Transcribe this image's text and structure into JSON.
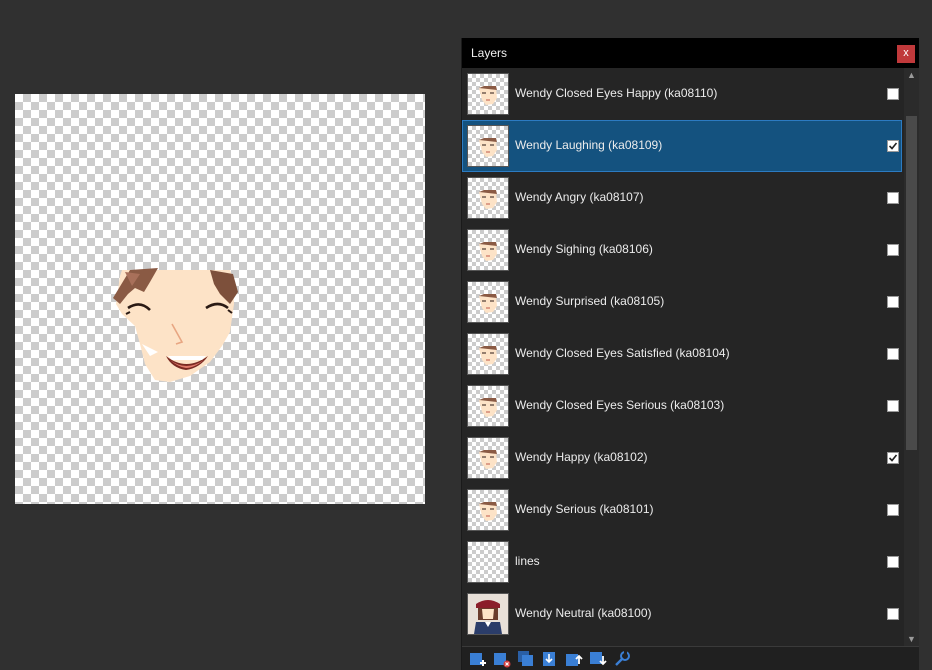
{
  "panel": {
    "title": "Layers",
    "close_label": "x"
  },
  "layers": [
    {
      "name": "Wendy Closed Eyes Happy (ka08110)",
      "visible": false,
      "selected": false,
      "thumb": "face-icon"
    },
    {
      "name": "Wendy Laughing (ka08109)",
      "visible": true,
      "selected": true,
      "thumb": "face-icon"
    },
    {
      "name": "Wendy Angry (ka08107)",
      "visible": false,
      "selected": false,
      "thumb": "face-icon"
    },
    {
      "name": "Wendy Sighing (ka08106)",
      "visible": false,
      "selected": false,
      "thumb": "face-icon"
    },
    {
      "name": "Wendy Surprised (ka08105)",
      "visible": false,
      "selected": false,
      "thumb": "face-icon"
    },
    {
      "name": "Wendy Closed Eyes Satisfied (ka08104)",
      "visible": false,
      "selected": false,
      "thumb": "face-icon"
    },
    {
      "name": "Wendy Closed Eyes Serious (ka08103)",
      "visible": false,
      "selected": false,
      "thumb": "face-icon"
    },
    {
      "name": "Wendy Happy (ka08102)",
      "visible": true,
      "selected": false,
      "thumb": "face-icon"
    },
    {
      "name": "Wendy Serious (ka08101)",
      "visible": false,
      "selected": false,
      "thumb": "face-icon"
    },
    {
      "name": "lines",
      "visible": false,
      "selected": false,
      "thumb": "empty"
    },
    {
      "name": "Wendy Neutral (ka08100)",
      "visible": false,
      "selected": false,
      "thumb": "character-icon"
    }
  ],
  "toolbar": [
    {
      "name": "add-layer-icon"
    },
    {
      "name": "delete-layer-icon"
    },
    {
      "name": "duplicate-layer-icon"
    },
    {
      "name": "merge-layer-down-icon"
    },
    {
      "name": "move-layer-up-icon"
    },
    {
      "name": "move-layer-down-icon"
    },
    {
      "name": "layer-properties-icon"
    }
  ],
  "colors": {
    "background": "#303030",
    "panel": "#252525",
    "selection": "#14527f",
    "close_button": "#c0393b",
    "accent_icon": "#3a7fd5"
  }
}
